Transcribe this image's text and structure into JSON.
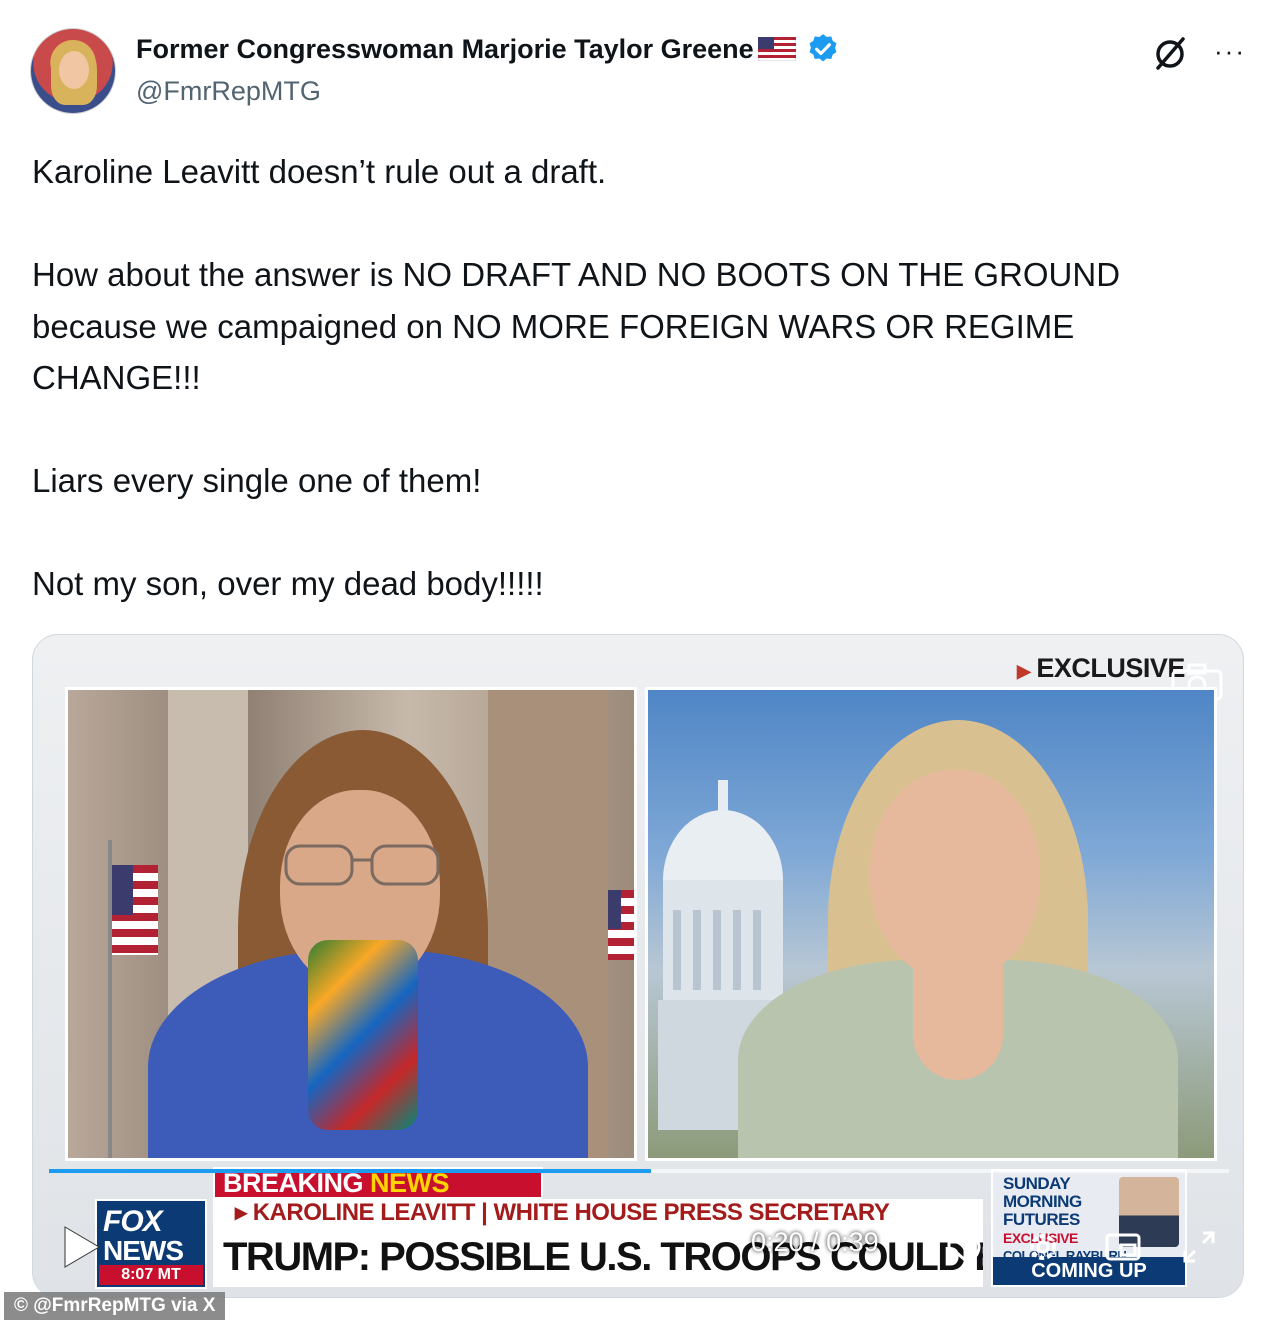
{
  "post": {
    "author": {
      "display_name": "Former Congresswoman Marjorie Taylor Greene",
      "handle": "@FmrRepMTG",
      "verified": true,
      "avatar_icon": "profile-photo",
      "flag_icon": "us-flag-emoji"
    },
    "actions": {
      "grok_icon": "grok-icon",
      "more_icon": "more-options-icon",
      "more_label": "···"
    },
    "text": [
      "Karoline Leavitt doesn’t rule out a draft.",
      "How about the answer is NO DRAFT AND NO BOOTS ON THE GROUND because we campaigned on NO MORE FOREIGN WARS OR REGIME CHANGE!!!",
      "Liars every single one of them!",
      "Not my son, over my dead body!!!!!"
    ]
  },
  "video": {
    "exclusive_label": "EXCLUSIVE",
    "breaking_label_1": "BREAKING ",
    "breaking_label_2": "NEWS",
    "nameplate": "▸ KAROLINE LEAVITT | WHITE HOUSE PRESS SECRETARY",
    "headline": "TRUMP: POSSIBLE U.S. TROOPS COULD BE SENT TO IRAN",
    "network_line1": "FOX",
    "network_line2": "NEWS",
    "clock": "8:07 MT",
    "promo_line1": "SUNDAY",
    "promo_line2": "MORNING",
    "promo_line3": "FUTURES",
    "promo_tag": "EXCLUSIVE",
    "promo_guest": "COLONEL RAYBURN",
    "promo_footer": "COMING UP",
    "current_time": "0:20",
    "duration": "0:39",
    "time_separator": " / ",
    "progress": 0.51,
    "controls": [
      "play-icon",
      "volume-icon",
      "settings-icon",
      "picture-in-picture-icon",
      "fullscreen-icon"
    ]
  },
  "watermark": "© @FmrRepMTG via X",
  "colors": {
    "accent": "#1d9bf0",
    "fox_red": "#c8102e",
    "fox_blue": "#0b3a75",
    "handle_gray": "#536471"
  }
}
